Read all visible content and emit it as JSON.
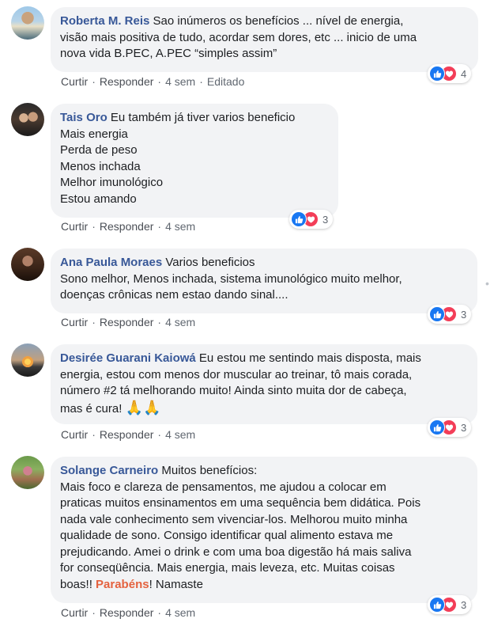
{
  "action_labels": {
    "like": "Curtir",
    "reply": "Responder",
    "sep": "·"
  },
  "comments": [
    {
      "author": "Roberta M. Reis",
      "first_line": " Sao inúmeros os benefícios ... nível de energia,",
      "lines": [
        "visão mais positiva de tudo, acordar sem dores, etc ... inicio de uma",
        "nova vida B.PEC, A.PEC “simples assim”"
      ],
      "time": "4 sem",
      "edited": "Editado",
      "reaction_count": "4"
    },
    {
      "author": "Tais Oro",
      "first_line": " Eu também já tiver varios beneficio",
      "lines": [
        "Mais energia",
        "Perda de peso",
        "Menos inchada",
        "Melhor imunológico",
        "Estou amando"
      ],
      "time": "4 sem",
      "reaction_count": "3"
    },
    {
      "author": "Ana Paula Moraes",
      "first_line": " Varios beneficios",
      "lines": [
        "Sono melhor, Menos inchada, sistema imunológico muito melhor,",
        "doenças crônicas nem estao dando sinal...."
      ],
      "time": "4 sem",
      "reaction_count": "3"
    },
    {
      "author": "Desirée Guarani Kaiowá",
      "first_line": " Eu estou me sentindo mais disposta, mais",
      "lines": [
        "energia, estou com menos dor muscular ao treinar, tô mais corada,",
        "número #2 tá melhorando muito! Ainda sinto muita dor de cabeça,",
        "mas é cura! "
      ],
      "emoji": "🙏🙏",
      "time": "4 sem",
      "reaction_count": "3"
    },
    {
      "author": "Solange Carneiro",
      "first_line": " Muitos benefícios:",
      "lines": [
        "Mais foco e clareza de pensamentos, me ajudou a colocar em",
        "praticas muitos ensinamentos em uma sequência bem didática. Pois",
        "nada vale conhecimento sem vivenciar-los. Melhorou muito minha",
        "qualidade de sono. Consigo identificar qual alimento estava me",
        "prejudicando. Amei o drink e com uma boa digestão há mais saliva",
        "for conseqüência. Mais energia, mais leveza, etc. Muitas coisas"
      ],
      "last_line": {
        "before": "boas!! ",
        "highlight": "Parabéns",
        "after": "! Namaste"
      },
      "time": "4 sem",
      "reaction_count": "3"
    }
  ],
  "more_dots": "•"
}
